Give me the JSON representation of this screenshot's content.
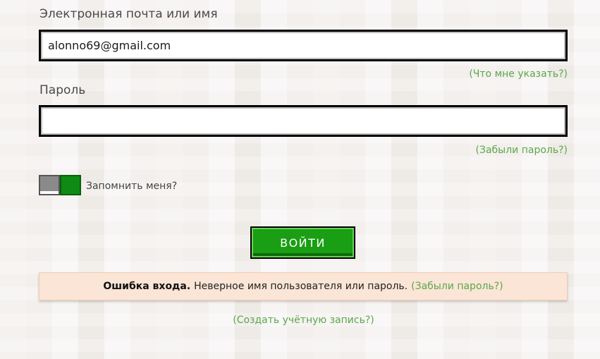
{
  "email": {
    "label": "Электронная почта или имя",
    "value": "alonno69@gmail.com",
    "help_link": "(Что мне указать?)"
  },
  "password": {
    "label": "Пароль",
    "value": "",
    "help_link": "(Забыли пароль?)"
  },
  "remember": {
    "label": "Запомнить меня?",
    "enabled": true
  },
  "login_button": {
    "label": "ВОЙТИ"
  },
  "error": {
    "title": "Ошибка входа.",
    "message": "Неверное имя пользователя или пароль.",
    "link": "(Забыли пароль?)"
  },
  "create_account_link": "(Создать учётную запись?)",
  "colors": {
    "accent_green": "#1a9e13",
    "link_green": "#5aa84a",
    "error_bg": "#fbe5d6"
  }
}
